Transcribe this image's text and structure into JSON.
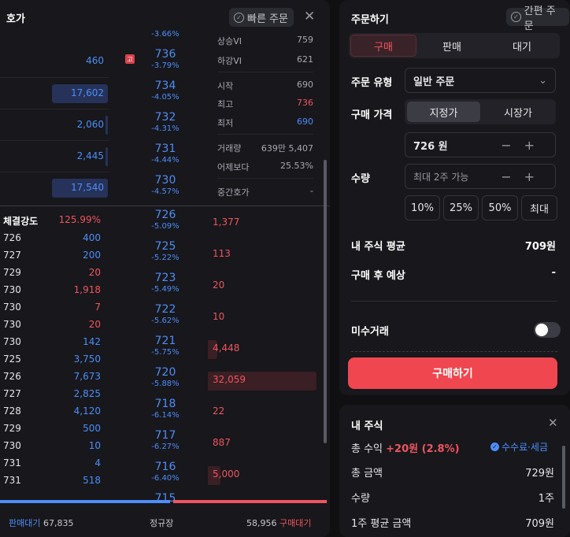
{
  "orderbook": {
    "title": "호가",
    "quick_order_label": "빠른 주문",
    "sell_side": [
      {
        "qty": "460"
      },
      {
        "qty": "17,602"
      },
      {
        "qty": "2,060"
      },
      {
        "qty": "2,445"
      },
      {
        "qty": "17,540"
      }
    ],
    "ask_prices": [
      {
        "price": "736",
        "change": "-3.79%"
      },
      {
        "price": "734",
        "change": "-4.05%"
      },
      {
        "price": "732",
        "change": "-4.31%"
      },
      {
        "price": "731",
        "change": "-4.44%"
      },
      {
        "price": "730",
        "change": "-4.57%"
      }
    ],
    "bid_prices": [
      {
        "price": "726",
        "change": "-5.09%"
      },
      {
        "price": "725",
        "change": "-5.22%"
      },
      {
        "price": "723",
        "change": "-5.49%"
      },
      {
        "price": "722",
        "change": "-5.62%"
      },
      {
        "price": "721",
        "change": "-5.75%"
      },
      {
        "price": "720",
        "change": "-5.88%"
      },
      {
        "price": "718",
        "change": "-6.14%"
      },
      {
        "price": "717",
        "change": "-6.27%"
      },
      {
        "price": "716",
        "change": "-6.40%"
      }
    ],
    "bid_qty": [
      "1,377",
      "113",
      "20",
      "10",
      "4,448",
      "32,059",
      "22",
      "887",
      "5,000"
    ],
    "top_partial_change": "-3.66%",
    "high_badge": "고",
    "info": [
      {
        "label": "상승VI",
        "value": "759"
      },
      {
        "label": "하강VI",
        "value": "621"
      },
      {
        "label": "시작",
        "value": "690"
      },
      {
        "label": "최고",
        "value": "736"
      },
      {
        "label": "최저",
        "value": "690"
      },
      {
        "label": "거래량",
        "value": "639만 5,407"
      },
      {
        "label": "어제보다",
        "value": "25.53%"
      },
      {
        "label": "중간호가",
        "value": "-"
      }
    ],
    "strength_label": "체결강도",
    "strength_value": "125.99%",
    "trades": [
      {
        "price": "726",
        "qty": "400",
        "side": "buy"
      },
      {
        "price": "727",
        "qty": "200",
        "side": "buy"
      },
      {
        "price": "729",
        "qty": "20",
        "side": "sell"
      },
      {
        "price": "730",
        "qty": "1,918",
        "side": "sell"
      },
      {
        "price": "730",
        "qty": "7",
        "side": "sell"
      },
      {
        "price": "730",
        "qty": "20",
        "side": "sell"
      },
      {
        "price": "730",
        "qty": "142",
        "side": "buy"
      },
      {
        "price": "725",
        "qty": "3,750",
        "side": "buy"
      },
      {
        "price": "726",
        "qty": "7,673",
        "side": "buy"
      },
      {
        "price": "727",
        "qty": "2,825",
        "side": "buy"
      },
      {
        "price": "728",
        "qty": "4,120",
        "side": "buy"
      },
      {
        "price": "729",
        "qty": "500",
        "side": "buy"
      },
      {
        "price": "730",
        "qty": "10",
        "side": "buy"
      },
      {
        "price": "731",
        "qty": "4",
        "side": "buy"
      },
      {
        "price": "731",
        "qty": "518",
        "side": "buy"
      }
    ],
    "partial_bottom_price": "715",
    "footer": {
      "sell_wait_label": "판매대기",
      "sell_wait_value": "67,835",
      "session": "정규장",
      "buy_wait_value": "58,956",
      "buy_wait_label": "구매대기"
    }
  },
  "order": {
    "title": "주문하기",
    "simple_order_label": "간편 주문",
    "tabs": [
      "구매",
      "판매",
      "대기"
    ],
    "order_type_label": "주문 유형",
    "order_type_value": "일반 주문",
    "buy_price_label": "구매 가격",
    "price_modes": [
      "지정가",
      "시장가"
    ],
    "price_value": "726 원",
    "qty_label": "수량",
    "qty_placeholder": "최대 2주 가능",
    "pct_buttons": [
      "10%",
      "25%",
      "50%",
      "최대"
    ],
    "avg_label": "내 주식 평균",
    "avg_value": "709원",
    "after_label": "구매 후 예상",
    "after_value": "-",
    "margin_label": "미수거래",
    "buy_button": "구매하기"
  },
  "my_stock": {
    "title": "내 주식",
    "profit_label": "총 수익",
    "profit_value": "+20원 (2.8%)",
    "fee_label": "수수료·세금",
    "total_label": "총 금액",
    "total_value": "729원",
    "qty_label": "수량",
    "qty_value": "1주",
    "avg_label": "1주 평균 금액",
    "avg_value": "709원"
  },
  "colors": {
    "blue": "#4d8ef7",
    "red": "#f0555f",
    "buy_accent": "#f0464f"
  }
}
